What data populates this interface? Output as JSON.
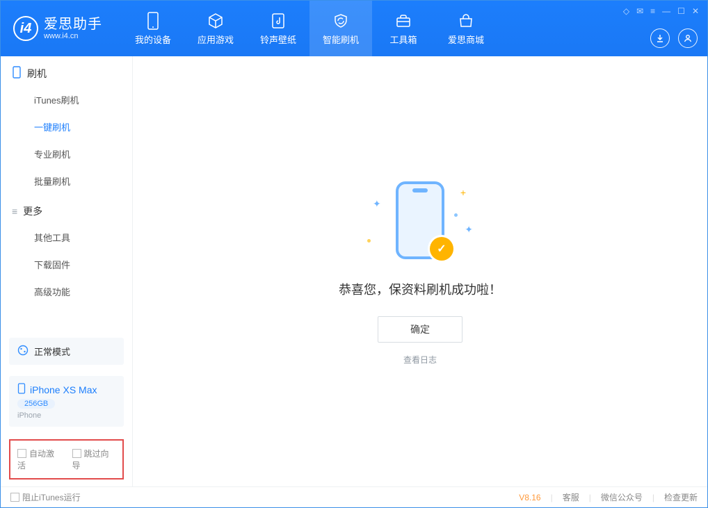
{
  "app": {
    "title": "爱思助手",
    "subtitle": "www.i4.cn"
  },
  "nav": {
    "tabs": [
      {
        "label": "我的设备"
      },
      {
        "label": "应用游戏"
      },
      {
        "label": "铃声壁纸"
      },
      {
        "label": "智能刷机"
      },
      {
        "label": "工具箱"
      },
      {
        "label": "爱思商城"
      }
    ],
    "activeIndex": 3
  },
  "sidebar": {
    "section1_title": "刷机",
    "section1_items": [
      {
        "label": "iTunes刷机"
      },
      {
        "label": "一键刷机"
      },
      {
        "label": "专业刷机"
      },
      {
        "label": "批量刷机"
      }
    ],
    "section1_active": 1,
    "section2_title": "更多",
    "section2_items": [
      {
        "label": "其他工具"
      },
      {
        "label": "下载固件"
      },
      {
        "label": "高级功能"
      }
    ],
    "mode_label": "正常模式",
    "device": {
      "name": "iPhone XS Max",
      "storage": "256GB",
      "type": "iPhone"
    },
    "check_auto_activate": "自动激活",
    "check_skip_guide": "跳过向导"
  },
  "main": {
    "success_message": "恭喜您，保资料刷机成功啦！",
    "ok_label": "确定",
    "view_log_label": "查看日志"
  },
  "footer": {
    "block_itunes": "阻止iTunes运行",
    "version": "V8.16",
    "links": [
      "客服",
      "微信公众号",
      "检查更新"
    ]
  }
}
